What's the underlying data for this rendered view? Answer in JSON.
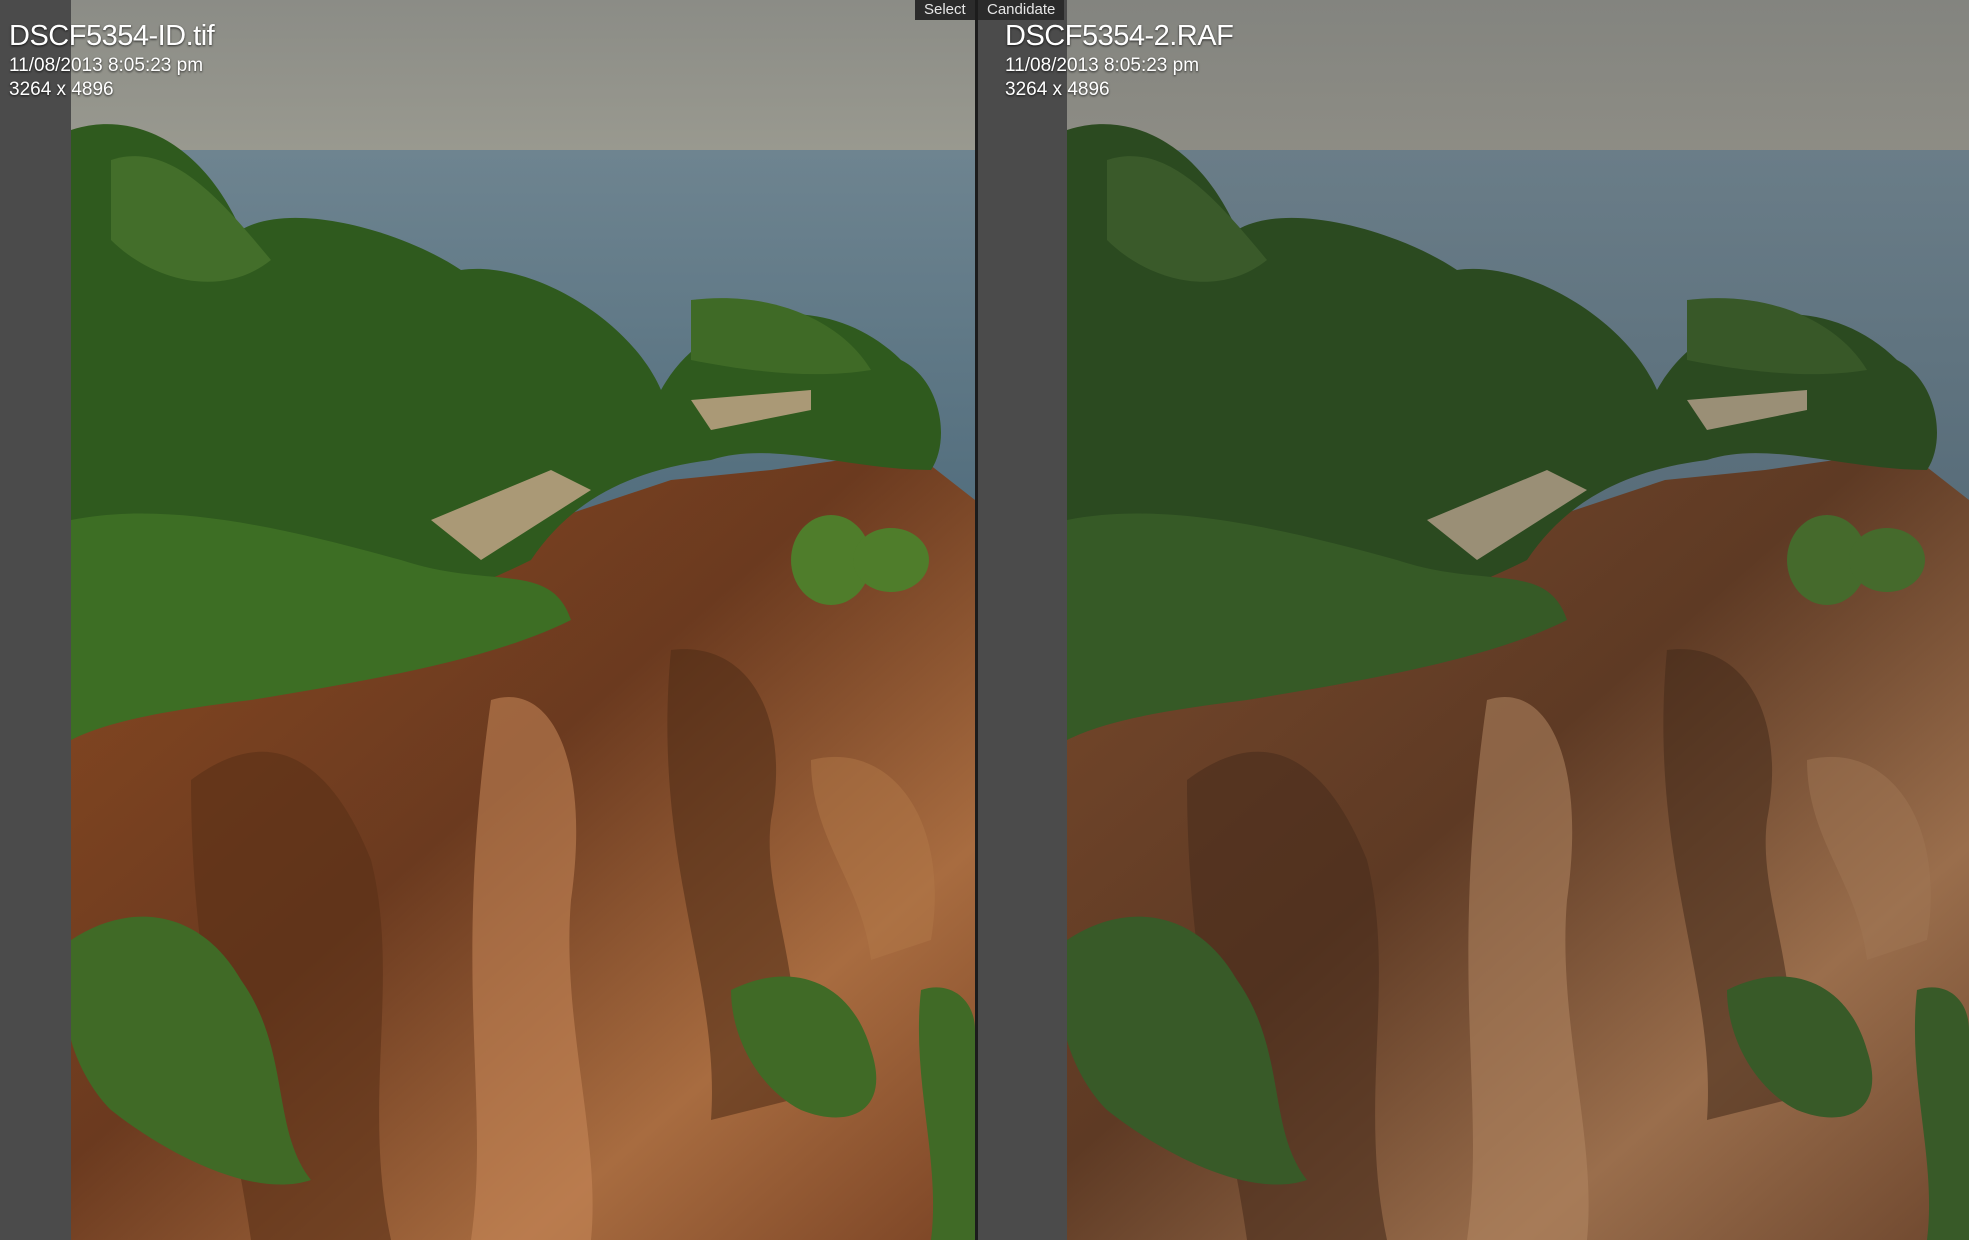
{
  "compare": {
    "select": {
      "badge": "Select",
      "filename": "DSCF5354-ID.tif",
      "datetime": "11/08/2013 8:05:23 pm",
      "dimensions": "3264 x 4896"
    },
    "candidate": {
      "badge": "Candidate",
      "filename": "DSCF5354-2.RAF",
      "datetime": "11/08/2013 8:05:23 pm",
      "dimensions": "3264 x 4896"
    }
  },
  "colors": {
    "background": "#4a4a4a",
    "badge_bg": "#2b2b2b",
    "divider": "#1c1c1c",
    "sea": "#5e7785",
    "foliage": "#2f5a1e",
    "cliff": "#7a4422"
  }
}
